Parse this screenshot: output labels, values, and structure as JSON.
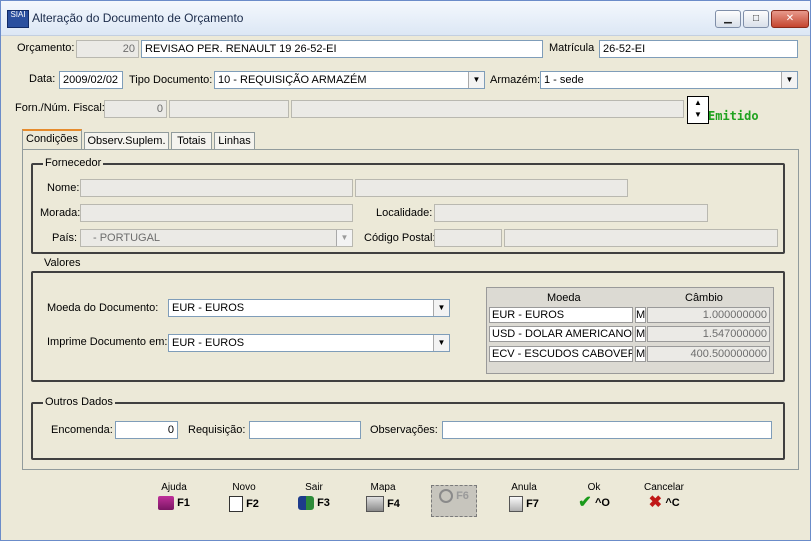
{
  "window": {
    "title": "Alteração do Documento de Orçamento",
    "app_icon_text": "SIAI",
    "controls": {
      "minimize": "▁",
      "maximize": "□",
      "close": "✕"
    }
  },
  "header": {
    "orcamento_label": "Orçamento:",
    "orcamento_number": "20",
    "orcamento_desc": "REVISAO PER. RENAULT 19 26-52-EI",
    "matricula_label": "Matrícula",
    "matricula_value": "26-52-EI",
    "data_label": "Data:",
    "data_value": "2009/02/02",
    "tipo_doc_label": "Tipo Documento:",
    "tipo_doc_value": "10 - REQUISIÇÃO ARMAZÉM",
    "armazem_label": "Armazém:",
    "armazem_value": "1 - sede",
    "forn_label": "Forn./Núm. Fiscal:",
    "forn_value": "0",
    "status_text": "Emitido"
  },
  "tabs": [
    {
      "label": "Condições"
    },
    {
      "label": "Observ.Suplem."
    },
    {
      "label": "Totais"
    },
    {
      "label": "Linhas"
    }
  ],
  "fornecedor": {
    "title": "Fornecedor",
    "nome_label": "Nome:",
    "morada_label": "Morada:",
    "localidade_label": "Localidade:",
    "pais_label": "País:",
    "pais_value": "- PORTUGAL",
    "codigo_postal_label": "Código Postal:"
  },
  "valores": {
    "title": "Valores",
    "moeda_doc_label": "Moeda do Documento:",
    "moeda_doc_value": "EUR - EUROS",
    "imprime_label": "Imprime Documento em:",
    "imprime_value": "EUR - EUROS",
    "grid_headers": {
      "moeda": "Moeda",
      "cambio": "Câmbio"
    },
    "grid_rows": [
      {
        "moeda": "EUR - EUROS",
        "flag": "M",
        "cambio": "1.000000000"
      },
      {
        "moeda": "USD - DOLAR AMERICANO",
        "flag": "M",
        "cambio": "1.547000000"
      },
      {
        "moeda": "ECV - ESCUDOS CABOVERD",
        "flag": "M",
        "cambio": "400.500000000"
      }
    ]
  },
  "outros": {
    "title": "Outros Dados",
    "encomenda_label": "Encomenda:",
    "encomenda_value": "0",
    "requisicao_label": "Requisição:",
    "requisicao_value": "",
    "observacoes_label": "Observações:",
    "observacoes_value": ""
  },
  "buttons": [
    {
      "caption": "Ajuda",
      "key": "F1",
      "icon": "book-icon",
      "enabled": true
    },
    {
      "caption": "Novo",
      "key": "F2",
      "icon": "new-document-icon",
      "enabled": true
    },
    {
      "caption": "Sair",
      "key": "F3",
      "icon": "exit-people-icon",
      "enabled": true
    },
    {
      "caption": "Mapa",
      "key": "F4",
      "icon": "printer-icon",
      "enabled": true
    },
    {
      "caption": "",
      "key": "F6",
      "icon": "search-icon",
      "enabled": false
    },
    {
      "caption": "Anula",
      "key": "F7",
      "icon": "trash-icon",
      "enabled": true
    },
    {
      "caption": "Ok",
      "key": "^O",
      "icon": "checkmark-icon",
      "enabled": true
    },
    {
      "caption": "Cancelar",
      "key": "^C",
      "icon": "cross-icon",
      "enabled": true
    }
  ],
  "colors": {
    "status_green": "#1fa31f",
    "dialog_bg": "#ece9d8",
    "tab_highlight": "#e68b2c"
  }
}
